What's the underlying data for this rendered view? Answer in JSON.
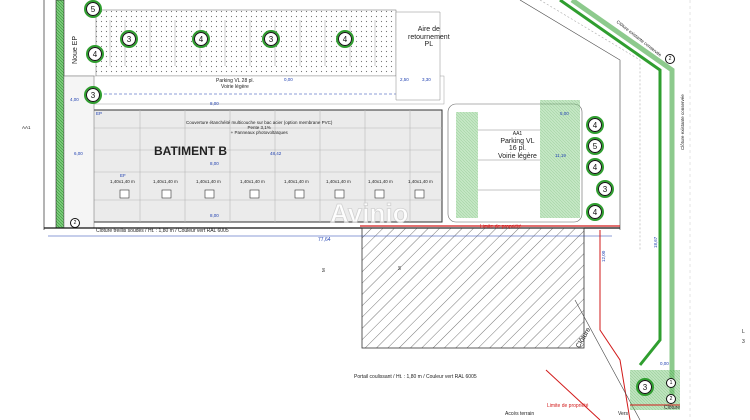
{
  "top_labels": {
    "aire_retournement_line1": "Aire de",
    "aire_retournement_line2": "retournement",
    "aire_retournement_line3": "PL",
    "parking_vl_top": "Parking VL 28 pl.",
    "voirie_legere_top": "Voirie légère",
    "noue_ep": "Noue EP"
  },
  "building": {
    "name": "BATIMENT B",
    "roof_line1": "Couverture étanchéité multicouche sur bac acier (option membrane PVC)",
    "roof_line2": "Pente 3,1%",
    "roof_line3": "+ Panneaux photovoltaïques",
    "width_dim": "48,42",
    "door_labels": [
      "1,40x1,40 m",
      "1,40x1,40 m",
      "1,40x1,40 m",
      "1,40x1,40 m",
      "1,40x1,40 m",
      "1,40x1,40 m",
      "1,40x1,40 m",
      "1,40x1,40 m"
    ],
    "ef_label": "EF",
    "ep_label": "EP"
  },
  "right_parking": {
    "title": "Parking VL",
    "count": "16 pl.",
    "subtitle": "Voirie légère",
    "section_tag": "AA1"
  },
  "fences": {
    "north": "Clôture existante conservée",
    "east": "Clôture existante conservée",
    "south_fence": "Clôture treillis soudés / Ht. : 1,80 m / Couleur vert RAL 6005",
    "gate": "Portail coulissant / Ht. : 1,80 m / Couleur vert RAL 6005",
    "cloture": "Clôture",
    "cloture_bottom": "Clôture",
    "limite_propriete": "Limite de propriété",
    "limite_propriete_top": "Limite de propriété",
    "limite_propriete_bottom": "Limite de propriété"
  },
  "dimensions": {
    "d_77_64": "77,64",
    "d_0_00_top": "0,00",
    "d_8_00_a": "8,00",
    "d_8_00_b": "8,00",
    "d_8_00_c": "8,00",
    "d_4_00": "4,00",
    "d_6_00": "6,00",
    "d_5_00": "5,00",
    "d_11_19": "11,19",
    "d_2_50": "2,50",
    "d_3_30": "3,30",
    "d_18_67": "18,67",
    "d_12_00": "12,00",
    "d_0_00_mid": "0,00"
  },
  "section_markers": {
    "aa1_left": "AA1",
    "m_a": "M",
    "m_b": "M"
  },
  "plantings": {
    "top_row": [
      "3",
      "4",
      "3",
      "4"
    ],
    "left_col": [
      "5",
      "4",
      "3"
    ],
    "right_col": [
      "4",
      "5",
      "4",
      "3",
      "4"
    ],
    "bottom_right": "3"
  },
  "point_tags": {
    "left_bottom": "2",
    "right_mid": "2",
    "bottom_right_a": "2",
    "bottom_right_b": "1"
  },
  "cutoff": {
    "bottom_left": "Accès terrain",
    "bottom_vers": "Vers",
    "right_edge_a": "L",
    "right_edge_b": "3"
  },
  "watermark": "Avinio",
  "colors": {
    "green_hatch": "#2f9e2f",
    "red_limit": "#d21a1a",
    "blue_dim": "#1e3fb0",
    "building_fill": "#ebebeb"
  }
}
